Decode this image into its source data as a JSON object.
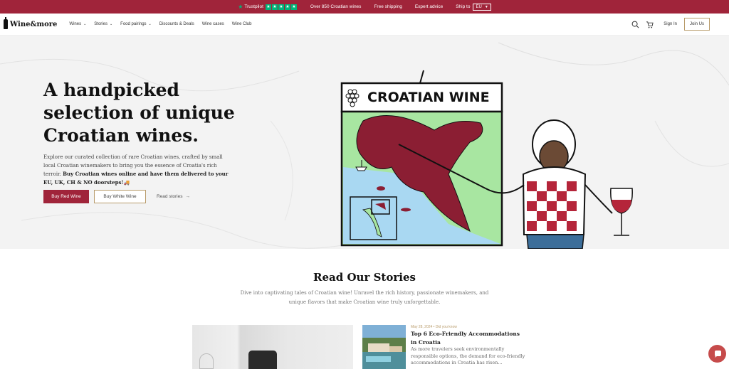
{
  "topbar": {
    "trustpilot": "Trustpilot",
    "stars": [
      "★",
      "★",
      "★",
      "★",
      "★"
    ],
    "items": [
      "Over 850 Croatian wines",
      "Free shipping",
      "Expert advice"
    ],
    "ship_to_label": "Ship to",
    "ship_to_value": "EU",
    "brand_color": "#a0243a",
    "trustpilot_color": "#00b67a"
  },
  "nav": {
    "logo": "Wine&more",
    "menu": [
      {
        "label": "Wines",
        "dropdown": true
      },
      {
        "label": "Stories",
        "dropdown": true
      },
      {
        "label": "Food pairings",
        "dropdown": true
      },
      {
        "label": "Discounts & Deals",
        "dropdown": false
      },
      {
        "label": "Wine cases",
        "dropdown": false
      },
      {
        "label": "Wine Club",
        "dropdown": false
      }
    ],
    "icons": [
      "search-icon",
      "cart-icon"
    ],
    "sign_in": "Sign In",
    "join_us": "Join Us"
  },
  "hero": {
    "title": "A handpicked selection of unique Croatian wines.",
    "description_plain": "Explore our curated collection of rare Croatian wines, crafted by small local Croatian winemakers to bring you the essence of Croatia's rich terroir. ",
    "description_bold": "Buy Croatian wines online and have them delivered to your EU, UK, CH & NO doorsteps!",
    "truck_emoji": "🚚",
    "btn_red": "Buy Red Wine",
    "btn_white": "Buy White Wine",
    "read_link": "Read stories",
    "illustration_sign": "CROATIAN WINE"
  },
  "stories": {
    "title": "Read Our Stories",
    "subtitle": "Dive into captivating tales of Croatian wine! Unravel the rich history, passionate winemakers, and unique flavors that make Croatian wine truly unforgettable.",
    "items": [
      {
        "meta": "May 28, 2024 • Did you know",
        "title": "Top 6 Eco-Friendly Accommodations in Croatia",
        "excerpt": "As more travelers seek environmentally responsible options, the demand for eco-friendly accommodations in Croatia has risen..."
      }
    ]
  }
}
